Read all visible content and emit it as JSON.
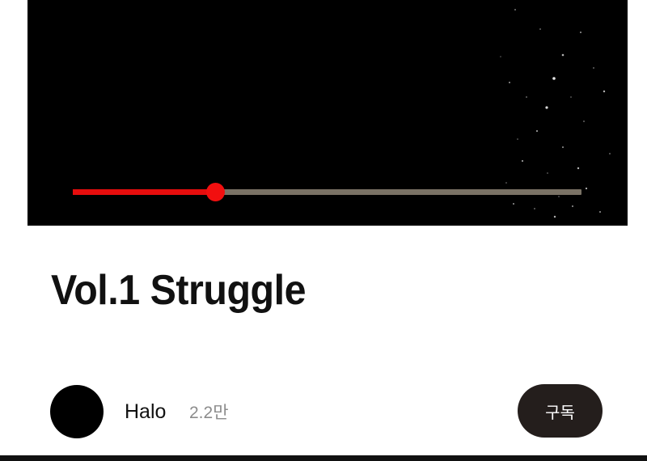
{
  "player": {
    "progress_fraction": 0.28,
    "played_color": "#e60d0d",
    "remaining_color": "#7a7265",
    "thumb_color": "#f20f0f"
  },
  "video": {
    "title": "Vol.1 Struggle"
  },
  "channel": {
    "name": "Halo",
    "subscriber_count": "2.2만",
    "avatar_color": "#000000"
  },
  "actions": {
    "subscribe_label": "구독",
    "subscribe_bg": "#241e1c"
  }
}
